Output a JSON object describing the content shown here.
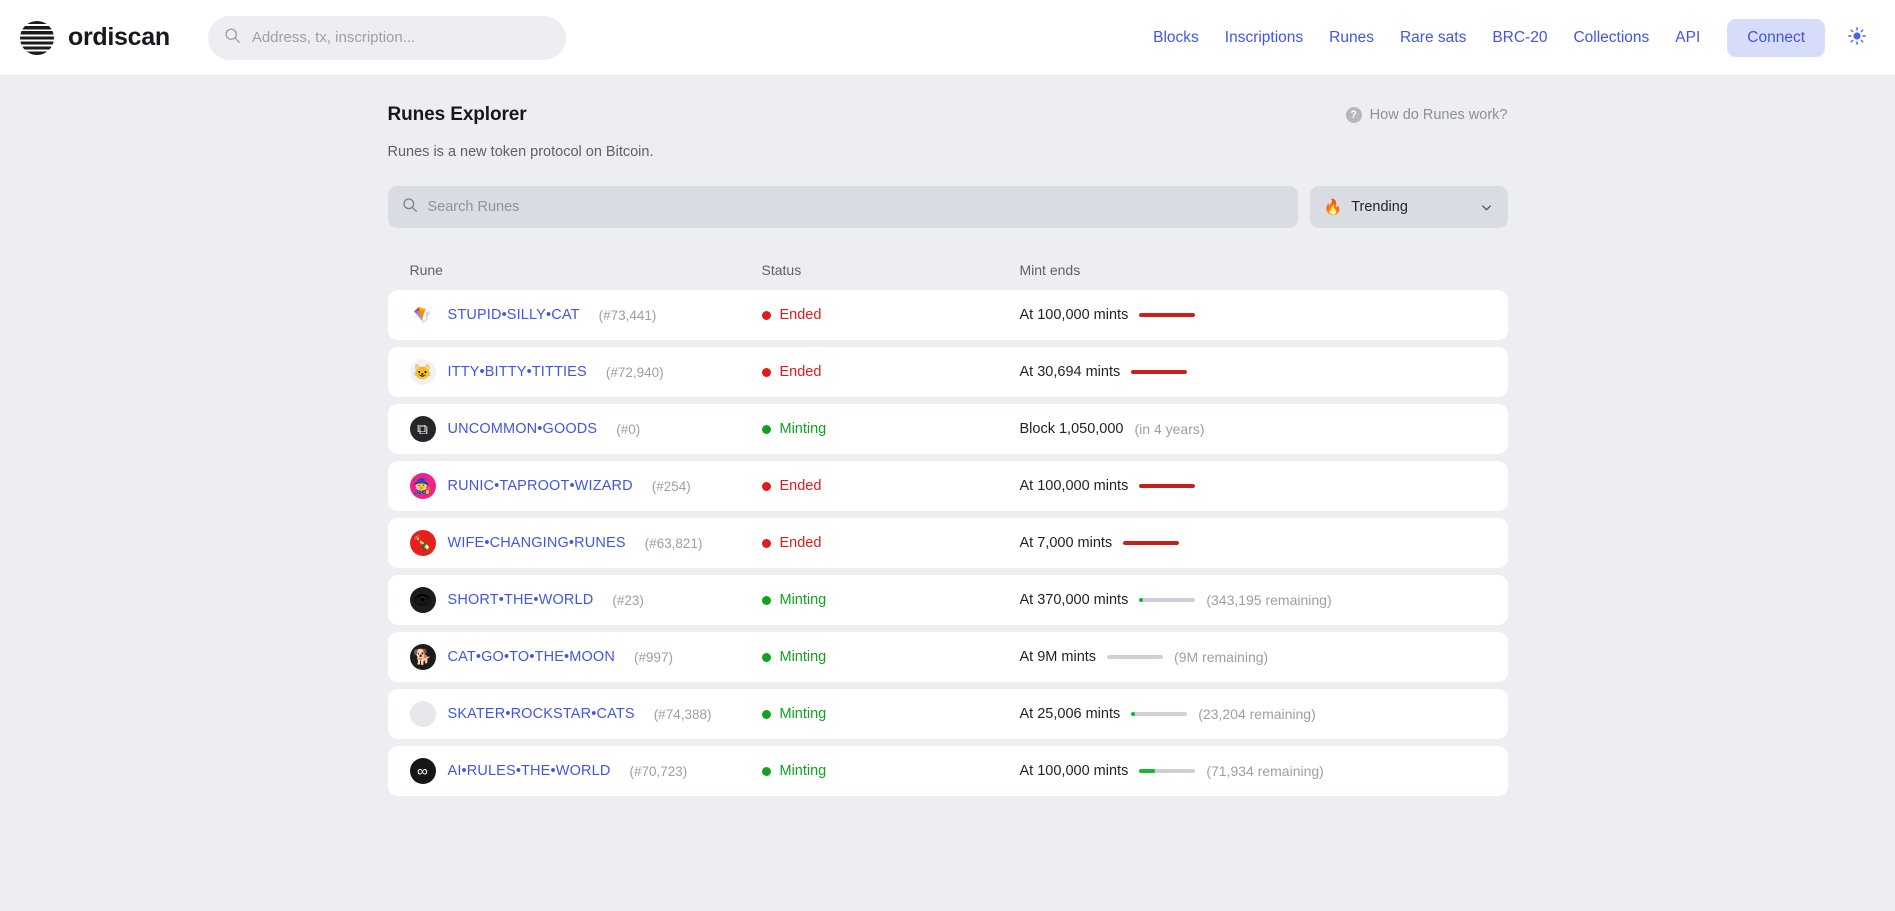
{
  "header": {
    "brand": "ordiscan",
    "search_placeholder": "Address, tx, inscription...",
    "search_value": "",
    "nav": [
      {
        "label": "Blocks"
      },
      {
        "label": "Inscriptions"
      },
      {
        "label": "Runes"
      },
      {
        "label": "Rare sats"
      },
      {
        "label": "BRC-20"
      },
      {
        "label": "Collections"
      },
      {
        "label": "API"
      }
    ],
    "connect_label": "Connect",
    "theme_icon": "sun-icon",
    "accent": "#4255e8",
    "connect_bg": "#d7dcfb"
  },
  "page": {
    "title": "Runes Explorer",
    "subtitle": "Runes is a new token protocol on Bitcoin.",
    "help_label": "How do Runes work?",
    "help_icon_glyph": "?"
  },
  "controls": {
    "search_placeholder": "Search Runes",
    "search_value": "",
    "search_icon": "search-icon",
    "sort_icon": "fire-icon",
    "sort_glyph": "🔥",
    "sort_label": "Trending",
    "chevron_icon": "chevron-down-icon"
  },
  "table": {
    "columns": [
      "Rune",
      "Status",
      "Mint ends"
    ],
    "rows": [
      {
        "name": "STUPID•SILLY•CAT",
        "number": "(#73,441)",
        "avatar_glyph": "🪁",
        "avatar_bg": "#ffffff",
        "status": "Ended",
        "status_color": "#e01b1b",
        "mint_text": "At 100,000 mints",
        "mint_sub": "",
        "bar": true,
        "bar_percent": 100,
        "bar_color": "#c8201b"
      },
      {
        "name": "ITTY•BITTY•TITTIES",
        "number": "(#72,940)",
        "avatar_glyph": "😺",
        "avatar_bg": "#f1f2f4",
        "status": "Ended",
        "status_color": "#e01b1b",
        "mint_text": "At 30,694 mints",
        "mint_sub": "",
        "bar": true,
        "bar_percent": 100,
        "bar_color": "#c8201b"
      },
      {
        "name": "UNCOMMON•GOODS",
        "number": "(#0)",
        "avatar_glyph": "⧉",
        "avatar_bg": "#26262a",
        "avatar_fg": "#ffffff",
        "status": "Minting",
        "status_color": "#0fa31f",
        "mint_text": "Block 1,050,000",
        "mint_sub": "(in 4 years)",
        "bar": false,
        "bar_percent": 0,
        "bar_color": ""
      },
      {
        "name": "RUNIC•TAPROOT•WIZARD",
        "number": "(#254)",
        "avatar_glyph": "🧙",
        "avatar_bg": "#f0208c",
        "status": "Ended",
        "status_color": "#e01b1b",
        "mint_text": "At 100,000 mints",
        "mint_sub": "",
        "bar": true,
        "bar_percent": 100,
        "bar_color": "#c8201b"
      },
      {
        "name": "WIFE•CHANGING•RUNES",
        "number": "(#63,821)",
        "avatar_glyph": "🍾",
        "avatar_bg": "#e81f1f",
        "status": "Ended",
        "status_color": "#e01b1b",
        "mint_text": "At 7,000 mints",
        "mint_sub": "",
        "bar": true,
        "bar_percent": 100,
        "bar_color": "#c8201b"
      },
      {
        "name": "SHORT•THE•WORLD",
        "number": "(#23)",
        "avatar_glyph": "👁",
        "avatar_bg": "#1c1c1c",
        "status": "Minting",
        "status_color": "#0fa31f",
        "mint_text": "At 370,000 mints",
        "mint_sub": "(343,195 remaining)",
        "bar": true,
        "bar_percent": 7,
        "bar_color": "#16b92b"
      },
      {
        "name": "CAT•GO•TO•THE•MOON",
        "number": "(#997)",
        "avatar_glyph": "🐕",
        "avatar_bg": "#1c1c1c",
        "status": "Minting",
        "status_color": "#0fa31f",
        "mint_text": "At 9M mints",
        "mint_sub": "(9M remaining)",
        "bar": true,
        "bar_percent": 0,
        "bar_color": "#16b92b"
      },
      {
        "name": "SKATER•ROCKSTAR•CATS",
        "number": "(#74,388)",
        "avatar_glyph": "",
        "avatar_bg": "#e6e8eb",
        "status": "Minting",
        "status_color": "#0fa31f",
        "mint_text": "At 25,006 mints",
        "mint_sub": "(23,204 remaining)",
        "bar": true,
        "bar_percent": 7,
        "bar_color": "#16b92b"
      },
      {
        "name": "AI•RULES•THE•WORLD",
        "number": "(#70,723)",
        "avatar_glyph": "∞",
        "avatar_bg": "#161616",
        "avatar_fg": "#ffffff",
        "status": "Minting",
        "status_color": "#0fa31f",
        "mint_text": "At 100,000 mints",
        "mint_sub": "(71,934 remaining)",
        "bar": true,
        "bar_percent": 28,
        "bar_color": "#16b92b"
      }
    ]
  }
}
